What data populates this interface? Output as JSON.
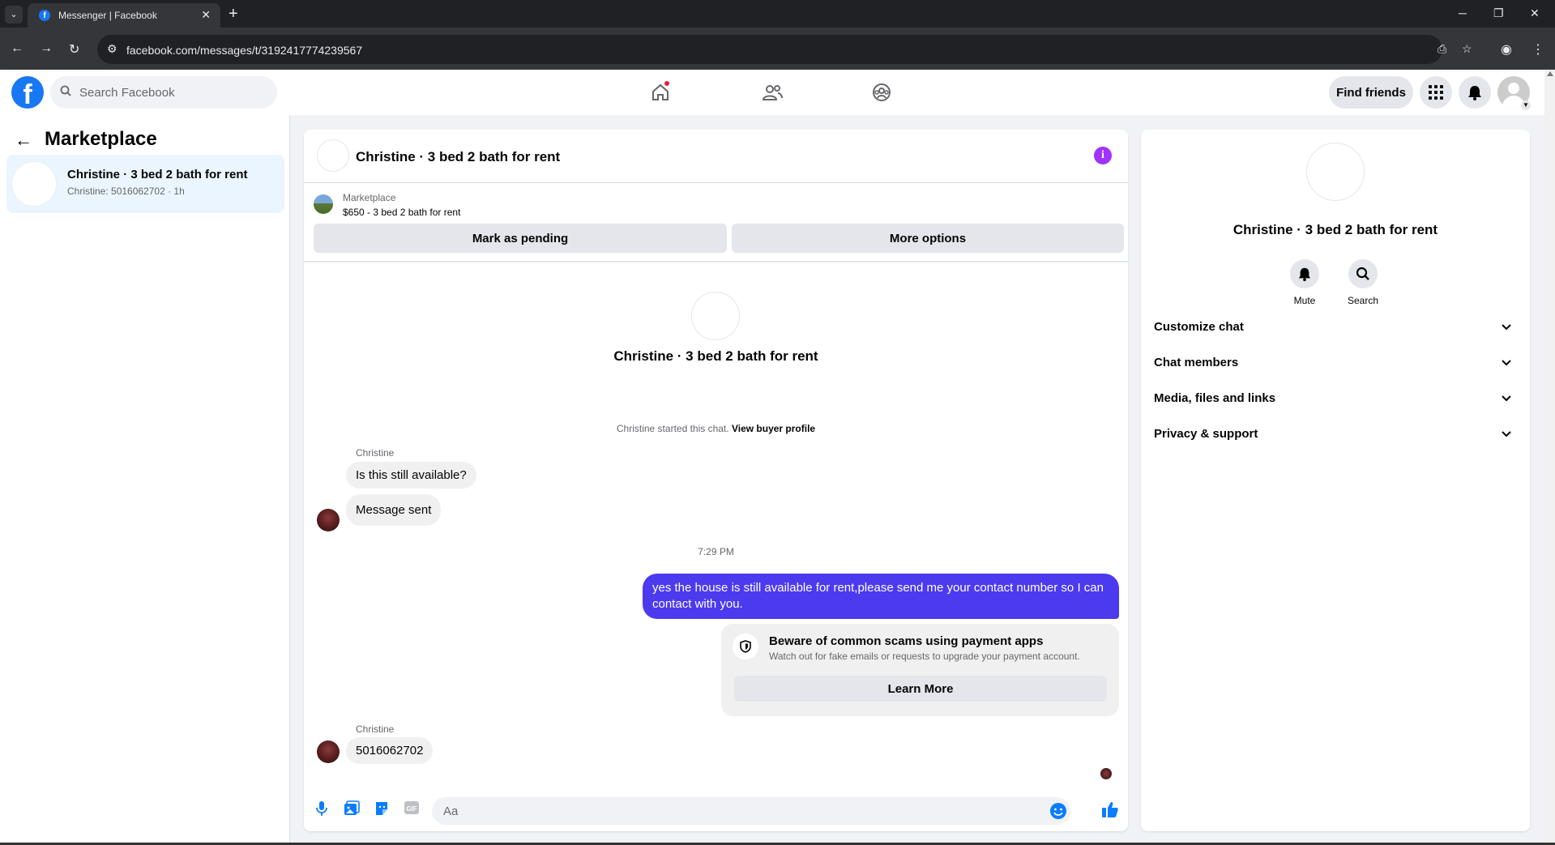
{
  "browser": {
    "tab_title": "Messenger | Facebook",
    "url": "facebook.com/messages/t/3192417774239567"
  },
  "fb_header": {
    "search_placeholder": "Search Facebook",
    "find_friends_label": "Find friends"
  },
  "sidebar": {
    "title": "Marketplace",
    "conversation": {
      "name": "Christine · 3 bed 2 bath for rent",
      "snippet": "Christine: 5016062702 · 1h"
    }
  },
  "chat": {
    "title": "Christine · 3 bed 2 bath for rent",
    "listing": {
      "category": "Marketplace",
      "price_title": "$650 - 3 bed 2 bath for rent",
      "mark_pending_label": "Mark as pending",
      "more_options_label": "More options"
    },
    "thread_name": "Christine · 3 bed 2 bath for rent",
    "system_message": "Christine started this chat.",
    "system_link": "View buyer profile",
    "messages": [
      {
        "sender": "Christine",
        "text": "Is this still available?"
      },
      {
        "text": "Message sent"
      },
      {
        "time": "7:29 PM"
      },
      {
        "text": "yes the house is still available for rent,please send me your contact number so I can contact with you."
      },
      {
        "sender": "Christine",
        "text": "5016062702"
      }
    ],
    "scam_warning": {
      "title": "Beware of common scams using payment apps",
      "subtitle": "Watch out for fake emails or requests to upgrade your payment account.",
      "button_label": "Learn More"
    },
    "composer_placeholder": "Aa"
  },
  "right_panel": {
    "name": "Christine · 3 bed 2 bath for rent",
    "actions": [
      "Mute",
      "Search"
    ],
    "sections": [
      "Customize chat",
      "Chat members",
      "Media, files and links",
      "Privacy & support"
    ]
  },
  "colors": {
    "fb_blue": "#1877f2",
    "outgoing_bubble": "#4c3aef",
    "info_purple": "#a033ff"
  }
}
